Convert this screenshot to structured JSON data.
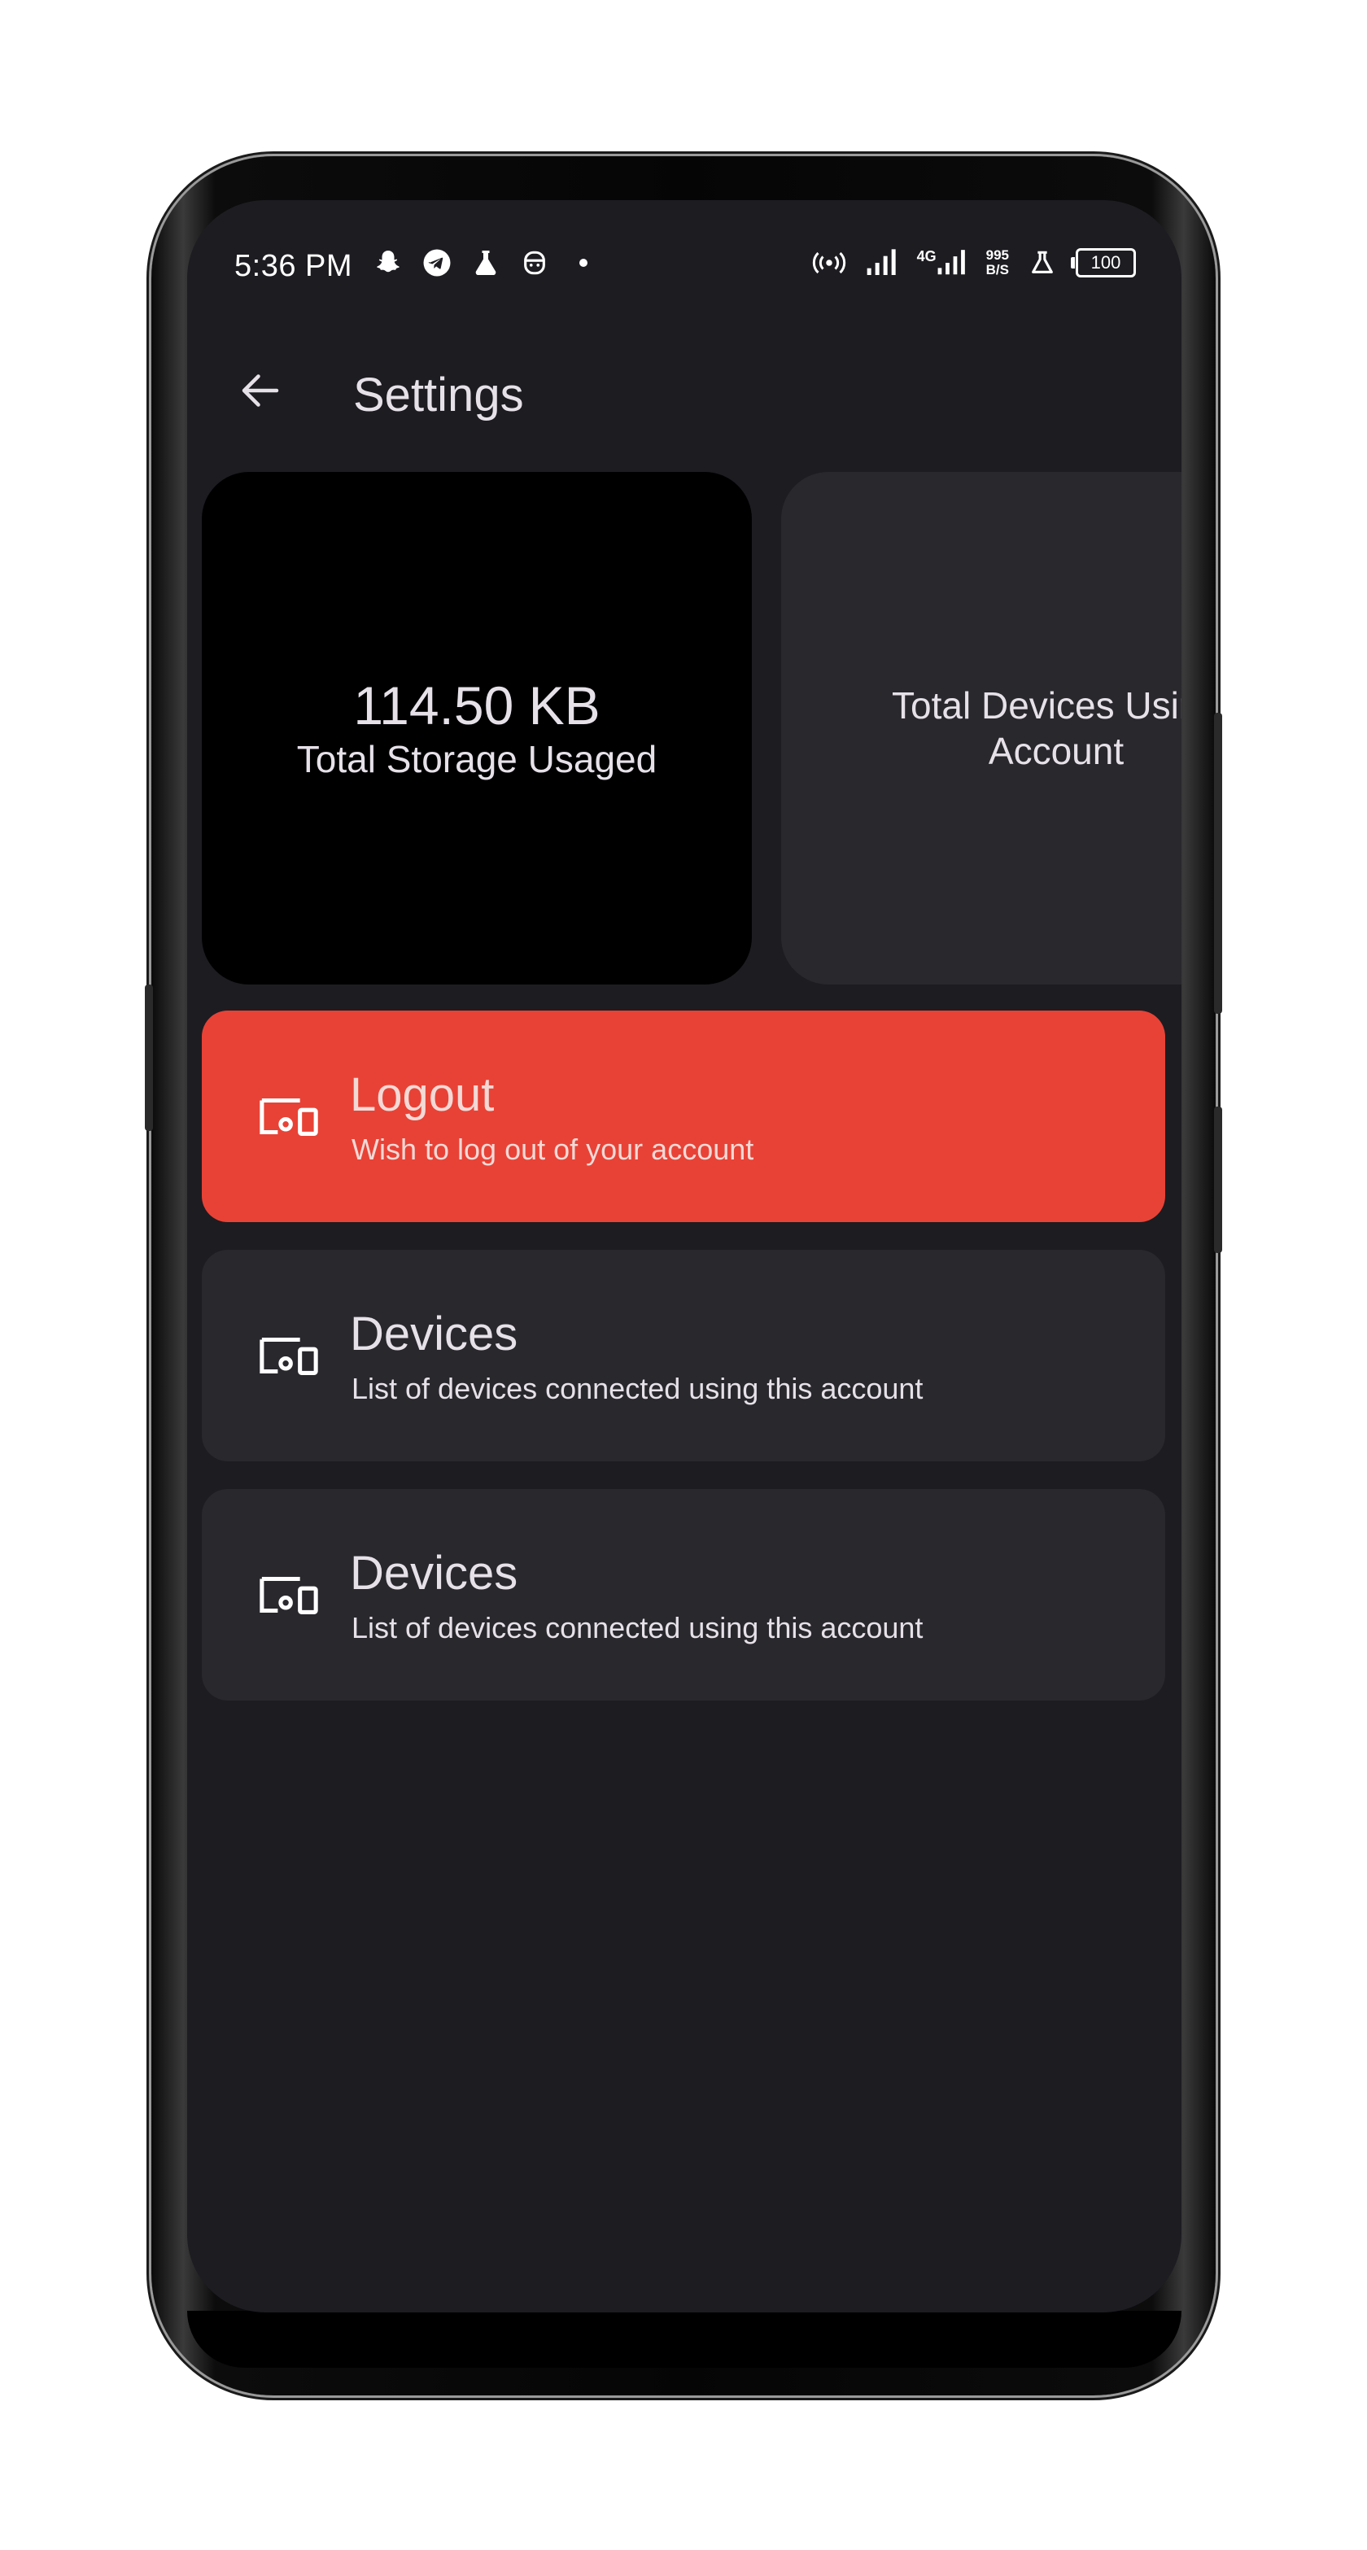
{
  "status_bar": {
    "time": "5:36 PM",
    "left_icons": [
      "snapchat-icon",
      "telegram-icon",
      "lab-flask-icon",
      "face-icon",
      "dot-icon"
    ],
    "net_speed_value": "995",
    "net_speed_unit": "B/S",
    "network_label": "4G",
    "battery": "100"
  },
  "appbar": {
    "title": "Settings",
    "back_icon": "arrow-left-icon"
  },
  "stats": {
    "storage": {
      "value": "114.50 KB",
      "label": "Total Storage Usaged"
    },
    "devices": {
      "value": "",
      "label": "Total Devices Using Account"
    }
  },
  "tiles": [
    {
      "icon": "devices-icon",
      "title": "Logout",
      "subtitle": "Wish to log out of your account",
      "color": "#e84236"
    },
    {
      "icon": "devices-icon",
      "title": "Devices",
      "subtitle": "List of devices connected using this account"
    },
    {
      "icon": "devices-icon",
      "title": "Devices",
      "subtitle": "List of devices connected using this account"
    }
  ],
  "colors": {
    "background": "#1d1c21",
    "card": "#29282d",
    "storage_card": "#000000",
    "danger": "#e84236",
    "text": "#e6e1e9"
  }
}
